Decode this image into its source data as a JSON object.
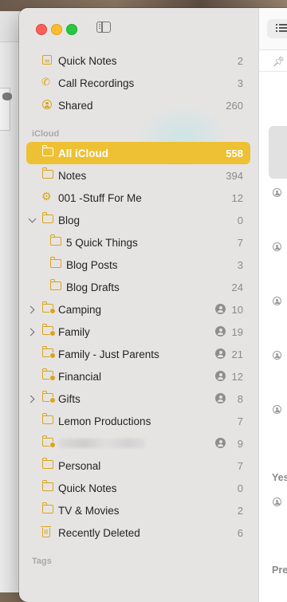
{
  "window": {
    "controls": [
      "close-button",
      "minimize-button",
      "zoom-button"
    ],
    "sidebar_toggle_icon": "sidebar-toggle-icon"
  },
  "sidebar": {
    "top_items": [
      {
        "label": "Quick Notes",
        "count": "2",
        "icon": "quick-notes-icon"
      },
      {
        "label": "Call Recordings",
        "count": "3",
        "icon": "phone-icon"
      },
      {
        "label": "Shared",
        "count": "260",
        "icon": "shared-person-icon"
      }
    ],
    "section_icloud": "iCloud",
    "folders": [
      {
        "label": "All iCloud",
        "count": "558",
        "selected": true
      },
      {
        "label": "Notes",
        "count": "394"
      },
      {
        "label": "001 -Stuff For Me",
        "count": "12",
        "icon": "smart-folder-gear-icon"
      },
      {
        "label": "Blog",
        "count": "0",
        "expanded": true
      },
      {
        "label": "5 Quick Things",
        "count": "7",
        "indent": 1
      },
      {
        "label": "Blog Posts",
        "count": "3",
        "indent": 1
      },
      {
        "label": "Blog Drafts",
        "count": "24",
        "indent": 1
      },
      {
        "label": "Camping",
        "count": "10",
        "shared": true,
        "collapsed": true
      },
      {
        "label": "Family",
        "count": "19",
        "shared": true,
        "collapsed": true
      },
      {
        "label": "Family - Just Parents",
        "count": "21",
        "shared": true
      },
      {
        "label": "Financial",
        "count": "12",
        "shared": true
      },
      {
        "label": "Gifts",
        "count": "8",
        "shared": true,
        "collapsed": true
      },
      {
        "label": "Lemon Productions",
        "count": "7"
      },
      {
        "label": "",
        "count": "9",
        "shared": true,
        "redacted": true
      },
      {
        "label": "Personal",
        "count": "7"
      },
      {
        "label": "Quick Notes",
        "count": "0"
      },
      {
        "label": "TV & Movies",
        "count": "2"
      },
      {
        "label": "Recently Deleted",
        "count": "6",
        "icon": "trash-icon"
      }
    ],
    "section_tags": "Tags"
  },
  "note_list": {
    "group_yesterday": "Yes",
    "group_previous": "Pre"
  },
  "colors": {
    "accent": "#edc133",
    "folder_icon": "#d9a51a",
    "sidebar_bg": "#e6e4e3"
  }
}
